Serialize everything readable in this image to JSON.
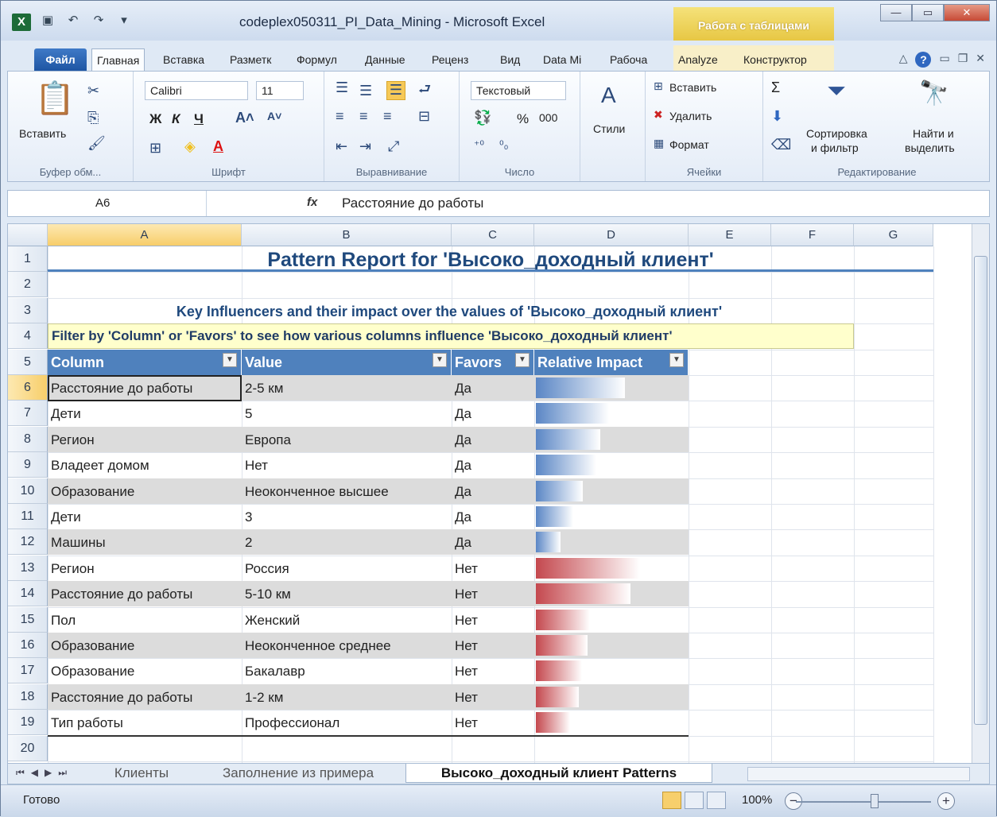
{
  "window": {
    "title": "codeplex050311_PI_Data_Mining - Microsoft Excel",
    "context_tab": "Работа с таблицами",
    "logo": "X"
  },
  "tabs": [
    "Файл",
    "Главная",
    "Вставка",
    "Разметк",
    "Формул",
    "Данные",
    "Реценз",
    "Вид",
    "Data Mi",
    "Рабоча",
    "Analyze",
    "Конструктор"
  ],
  "ribbon": {
    "paste_label": "Вставить",
    "clipboard_group": "Буфер обм...",
    "font_name": "Calibri",
    "font_size": "11",
    "font_group": "Шрифт",
    "bold": "Ж",
    "italic": "К",
    "underline": "Ч",
    "align_group": "Выравнивание",
    "number_format": "Текстовый",
    "percent": "%",
    "thousands": "000",
    "number_group": "Число",
    "styles_label": "Стили",
    "insert_label": "Вставить",
    "delete_label": "Удалить",
    "format_label": "Формат",
    "cells_group": "Ячейки",
    "sort_label_1": "Сортировка",
    "sort_label_2": "и фильтр",
    "find_label_1": "Найти и",
    "find_label_2": "выделить",
    "editing_group": "Редактирование",
    "sigma": "Σ"
  },
  "formula_bar": {
    "name_box": "A6",
    "fx": "fx",
    "content": "Расстояние до работы"
  },
  "columns": [
    "A",
    "B",
    "C",
    "D",
    "E",
    "F",
    "G"
  ],
  "rows": [
    "1",
    "2",
    "3",
    "4",
    "5",
    "6",
    "7",
    "8",
    "9",
    "10",
    "11",
    "12",
    "13",
    "14",
    "15",
    "16",
    "17",
    "18",
    "19",
    "20"
  ],
  "report": {
    "title": "Pattern Report for 'Высоко_доходный клиент'",
    "subtitle": "Key Influencers and their impact over the values of 'Высоко_доходный клиент'",
    "filter_hint": "Filter by 'Column' or 'Favors' to see how various columns influence 'Высоко_доходный клиент'",
    "headers": [
      "Column",
      "Value",
      "Favors",
      "Relative Impact"
    ],
    "rows": [
      {
        "column": "Расстояние до работы",
        "value": "2-5 км",
        "favors": "Да",
        "impact": 0.62
      },
      {
        "column": "Дети",
        "value": "5",
        "favors": "Да",
        "impact": 0.51
      },
      {
        "column": "Регион",
        "value": "Европа",
        "favors": "Да",
        "impact": 0.45
      },
      {
        "column": "Владеет домом",
        "value": "Нет",
        "favors": "Да",
        "impact": 0.42
      },
      {
        "column": "Образование",
        "value": "Неоконченное высшее",
        "favors": "Да",
        "impact": 0.33
      },
      {
        "column": "Дети",
        "value": "3",
        "favors": "Да",
        "impact": 0.26
      },
      {
        "column": "Машины",
        "value": "2",
        "favors": "Да",
        "impact": 0.17
      },
      {
        "column": "Регион",
        "value": "Россия",
        "favors": "Нет",
        "impact": 0.73
      },
      {
        "column": "Расстояние до работы",
        "value": "5-10 км",
        "favors": "Нет",
        "impact": 0.66
      },
      {
        "column": "Пол",
        "value": "Женский",
        "favors": "Нет",
        "impact": 0.38
      },
      {
        "column": "Образование",
        "value": "Неоконченное среднее",
        "favors": "Нет",
        "impact": 0.36
      },
      {
        "column": "Образование",
        "value": "Бакалавр",
        "favors": "Нет",
        "impact": 0.32
      },
      {
        "column": "Расстояние до работы",
        "value": "1-2 км",
        "favors": "Нет",
        "impact": 0.3
      },
      {
        "column": "Тип работы",
        "value": "Профессионал",
        "favors": "Нет",
        "impact": 0.24
      }
    ]
  },
  "sheet_tabs": [
    "Клиенты",
    "Заполнение из примера",
    "Высоко_доходный клиент Patterns"
  ],
  "status": {
    "ready": "Готово",
    "zoom": "100%"
  },
  "colors": {
    "header_blue": "#4f81bd",
    "favor_yes": "#5a86c5",
    "favor_no": "#c4484e"
  }
}
